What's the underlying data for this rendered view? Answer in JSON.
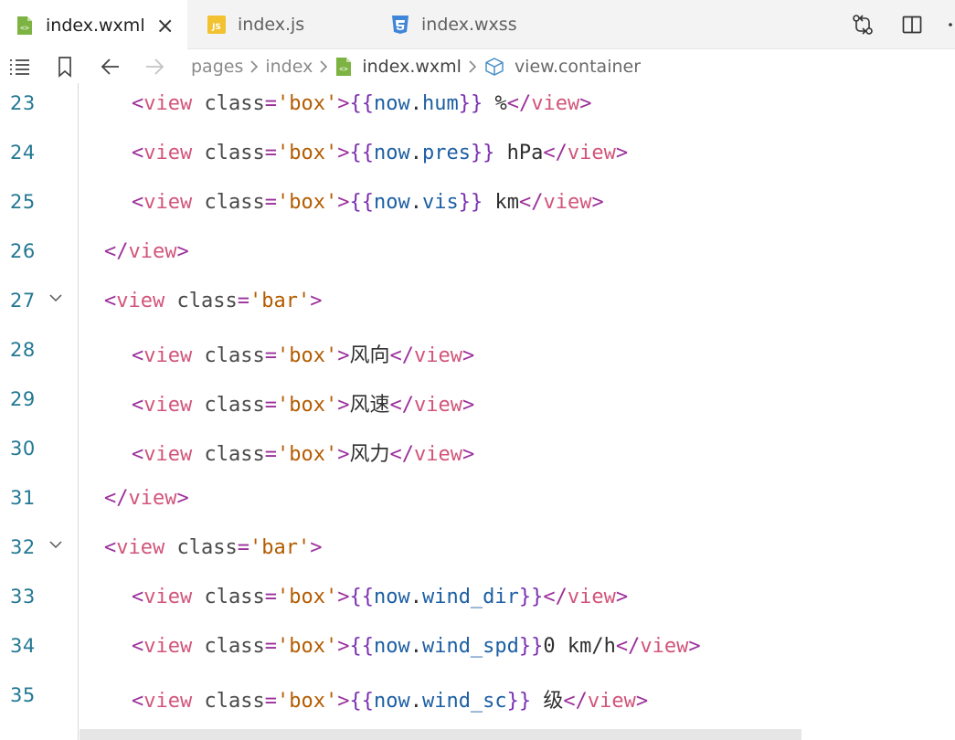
{
  "tabs": [
    {
      "label": "index.wxml",
      "icon": "wxml-file-icon",
      "active": true
    },
    {
      "label": "index.js",
      "icon": "js-file-icon",
      "active": false
    },
    {
      "label": "index.wxss",
      "icon": "css-file-icon",
      "active": false
    }
  ],
  "tab_close_glyph": "×",
  "breadcrumb": {
    "pages": "pages",
    "index": "index",
    "file": "index.wxml",
    "symbol": "view.container"
  },
  "editor": {
    "lines": [
      {
        "num": "23",
        "indent": 1,
        "fold": false,
        "tokens": [
          {
            "k": "punc",
            "t": "<"
          },
          {
            "k": "tag",
            "t": "view"
          },
          {
            "k": "txt",
            "t": " "
          },
          {
            "k": "attr",
            "t": "class"
          },
          {
            "k": "punc",
            "t": "="
          },
          {
            "k": "str",
            "t": "'box'"
          },
          {
            "k": "punc",
            "t": ">"
          },
          {
            "k": "tmpl",
            "t": "{{"
          },
          {
            "k": "var",
            "t": "now"
          },
          {
            "k": "txt",
            "t": "."
          },
          {
            "k": "var",
            "t": "hum"
          },
          {
            "k": "tmpl",
            "t": "}}"
          },
          {
            "k": "txt",
            "t": " %"
          },
          {
            "k": "punc",
            "t": "</"
          },
          {
            "k": "tag",
            "t": "view"
          },
          {
            "k": "punc",
            "t": ">"
          }
        ]
      },
      {
        "num": "24",
        "indent": 1,
        "fold": false,
        "tokens": [
          {
            "k": "punc",
            "t": "<"
          },
          {
            "k": "tag",
            "t": "view"
          },
          {
            "k": "txt",
            "t": " "
          },
          {
            "k": "attr",
            "t": "class"
          },
          {
            "k": "punc",
            "t": "="
          },
          {
            "k": "str",
            "t": "'box'"
          },
          {
            "k": "punc",
            "t": ">"
          },
          {
            "k": "tmpl",
            "t": "{{"
          },
          {
            "k": "var",
            "t": "now"
          },
          {
            "k": "txt",
            "t": "."
          },
          {
            "k": "var",
            "t": "pres"
          },
          {
            "k": "tmpl",
            "t": "}}"
          },
          {
            "k": "txt",
            "t": " hPa"
          },
          {
            "k": "punc",
            "t": "</"
          },
          {
            "k": "tag",
            "t": "view"
          },
          {
            "k": "punc",
            "t": ">"
          }
        ]
      },
      {
        "num": "25",
        "indent": 1,
        "fold": false,
        "tokens": [
          {
            "k": "punc",
            "t": "<"
          },
          {
            "k": "tag",
            "t": "view"
          },
          {
            "k": "txt",
            "t": " "
          },
          {
            "k": "attr",
            "t": "class"
          },
          {
            "k": "punc",
            "t": "="
          },
          {
            "k": "str",
            "t": "'box'"
          },
          {
            "k": "punc",
            "t": ">"
          },
          {
            "k": "tmpl",
            "t": "{{"
          },
          {
            "k": "var",
            "t": "now"
          },
          {
            "k": "txt",
            "t": "."
          },
          {
            "k": "var",
            "t": "vis"
          },
          {
            "k": "tmpl",
            "t": "}}"
          },
          {
            "k": "txt",
            "t": " km"
          },
          {
            "k": "punc",
            "t": "</"
          },
          {
            "k": "tag",
            "t": "view"
          },
          {
            "k": "punc",
            "t": ">"
          }
        ]
      },
      {
        "num": "26",
        "indent": 0,
        "fold": false,
        "tokens": [
          {
            "k": "punc",
            "t": "</"
          },
          {
            "k": "tag",
            "t": "view"
          },
          {
            "k": "punc",
            "t": ">"
          }
        ]
      },
      {
        "num": "27",
        "indent": 0,
        "fold": true,
        "tokens": [
          {
            "k": "punc",
            "t": "<"
          },
          {
            "k": "tag",
            "t": "view"
          },
          {
            "k": "txt",
            "t": " "
          },
          {
            "k": "attr",
            "t": "class"
          },
          {
            "k": "punc",
            "t": "="
          },
          {
            "k": "str",
            "t": "'bar'"
          },
          {
            "k": "punc",
            "t": ">"
          }
        ]
      },
      {
        "num": "28",
        "indent": 1,
        "fold": false,
        "tokens": [
          {
            "k": "punc",
            "t": "<"
          },
          {
            "k": "tag",
            "t": "view"
          },
          {
            "k": "txt",
            "t": " "
          },
          {
            "k": "attr",
            "t": "class"
          },
          {
            "k": "punc",
            "t": "="
          },
          {
            "k": "str",
            "t": "'box'"
          },
          {
            "k": "punc",
            "t": ">"
          },
          {
            "k": "txt",
            "t": "风向"
          },
          {
            "k": "punc",
            "t": "</"
          },
          {
            "k": "tag",
            "t": "view"
          },
          {
            "k": "punc",
            "t": ">"
          }
        ]
      },
      {
        "num": "29",
        "indent": 1,
        "fold": false,
        "tokens": [
          {
            "k": "punc",
            "t": "<"
          },
          {
            "k": "tag",
            "t": "view"
          },
          {
            "k": "txt",
            "t": " "
          },
          {
            "k": "attr",
            "t": "class"
          },
          {
            "k": "punc",
            "t": "="
          },
          {
            "k": "str",
            "t": "'box'"
          },
          {
            "k": "punc",
            "t": ">"
          },
          {
            "k": "txt",
            "t": "风速"
          },
          {
            "k": "punc",
            "t": "</"
          },
          {
            "k": "tag",
            "t": "view"
          },
          {
            "k": "punc",
            "t": ">"
          }
        ]
      },
      {
        "num": "30",
        "indent": 1,
        "fold": false,
        "tokens": [
          {
            "k": "punc",
            "t": "<"
          },
          {
            "k": "tag",
            "t": "view"
          },
          {
            "k": "txt",
            "t": " "
          },
          {
            "k": "attr",
            "t": "class"
          },
          {
            "k": "punc",
            "t": "="
          },
          {
            "k": "str",
            "t": "'box'"
          },
          {
            "k": "punc",
            "t": ">"
          },
          {
            "k": "txt",
            "t": "风力"
          },
          {
            "k": "punc",
            "t": "</"
          },
          {
            "k": "tag",
            "t": "view"
          },
          {
            "k": "punc",
            "t": ">"
          }
        ]
      },
      {
        "num": "31",
        "indent": 0,
        "fold": false,
        "tokens": [
          {
            "k": "punc",
            "t": "</"
          },
          {
            "k": "tag",
            "t": "view"
          },
          {
            "k": "punc",
            "t": ">"
          }
        ]
      },
      {
        "num": "32",
        "indent": 0,
        "fold": true,
        "tokens": [
          {
            "k": "punc",
            "t": "<"
          },
          {
            "k": "tag",
            "t": "view"
          },
          {
            "k": "txt",
            "t": " "
          },
          {
            "k": "attr",
            "t": "class"
          },
          {
            "k": "punc",
            "t": "="
          },
          {
            "k": "str",
            "t": "'bar'"
          },
          {
            "k": "punc",
            "t": ">"
          }
        ]
      },
      {
        "num": "33",
        "indent": 1,
        "fold": false,
        "tokens": [
          {
            "k": "punc",
            "t": "<"
          },
          {
            "k": "tag",
            "t": "view"
          },
          {
            "k": "txt",
            "t": " "
          },
          {
            "k": "attr",
            "t": "class"
          },
          {
            "k": "punc",
            "t": "="
          },
          {
            "k": "str",
            "t": "'box'"
          },
          {
            "k": "punc",
            "t": ">"
          },
          {
            "k": "tmpl",
            "t": "{{"
          },
          {
            "k": "var",
            "t": "now"
          },
          {
            "k": "txt",
            "t": "."
          },
          {
            "k": "var",
            "t": "wind_dir"
          },
          {
            "k": "tmpl",
            "t": "}}"
          },
          {
            "k": "punc",
            "t": "</"
          },
          {
            "k": "tag",
            "t": "view"
          },
          {
            "k": "punc",
            "t": ">"
          }
        ]
      },
      {
        "num": "34",
        "indent": 1,
        "fold": false,
        "tokens": [
          {
            "k": "punc",
            "t": "<"
          },
          {
            "k": "tag",
            "t": "view"
          },
          {
            "k": "txt",
            "t": " "
          },
          {
            "k": "attr",
            "t": "class"
          },
          {
            "k": "punc",
            "t": "="
          },
          {
            "k": "str",
            "t": "'box'"
          },
          {
            "k": "punc",
            "t": ">"
          },
          {
            "k": "tmpl",
            "t": "{{"
          },
          {
            "k": "var",
            "t": "now"
          },
          {
            "k": "txt",
            "t": "."
          },
          {
            "k": "var",
            "t": "wind_spd"
          },
          {
            "k": "tmpl",
            "t": "}}"
          },
          {
            "k": "txt",
            "t": "0 km/h"
          },
          {
            "k": "punc",
            "t": "</"
          },
          {
            "k": "tag",
            "t": "view"
          },
          {
            "k": "punc",
            "t": ">"
          }
        ]
      },
      {
        "num": "35",
        "indent": 1,
        "fold": false,
        "tokens": [
          {
            "k": "punc",
            "t": "<"
          },
          {
            "k": "tag",
            "t": "view"
          },
          {
            "k": "txt",
            "t": " "
          },
          {
            "k": "attr",
            "t": "class"
          },
          {
            "k": "punc",
            "t": "="
          },
          {
            "k": "str",
            "t": "'box'"
          },
          {
            "k": "punc",
            "t": ">"
          },
          {
            "k": "tmpl",
            "t": "{{"
          },
          {
            "k": "var",
            "t": "now"
          },
          {
            "k": "txt",
            "t": "."
          },
          {
            "k": "var",
            "t": "wind_sc"
          },
          {
            "k": "tmpl",
            "t": "}}"
          },
          {
            "k": "txt",
            "t": " 级"
          },
          {
            "k": "punc",
            "t": "</"
          },
          {
            "k": "tag",
            "t": "view"
          },
          {
            "k": "punc",
            "t": ">"
          }
        ]
      }
    ]
  },
  "colors": {
    "tab_bar_bg": "#f3f3f3",
    "line_number": "#237893",
    "tag": "#d2547a",
    "punctuation": "#9b2f9b",
    "string": "#b35c00",
    "variable": "#1d5fa3",
    "wxml_icon": "#7cb342",
    "js_icon": "#f2c230",
    "css_icon": "#3f86d8"
  }
}
